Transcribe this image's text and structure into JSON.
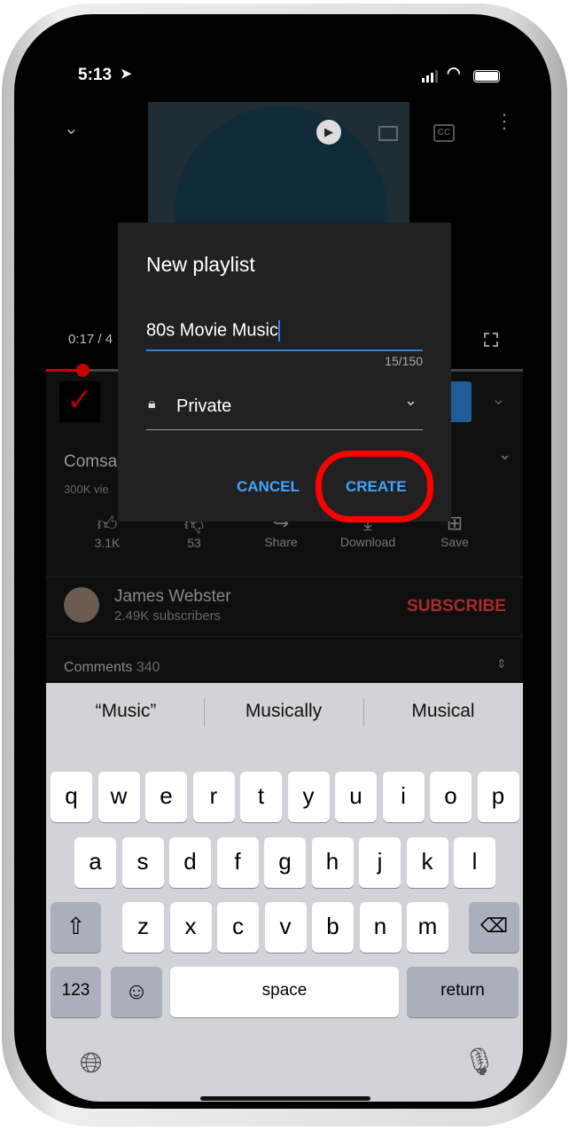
{
  "status_bar": {
    "time": "5:13"
  },
  "player": {
    "time": "0:17 / 4",
    "progress_fraction": 0.08
  },
  "video": {
    "title_partial": "Comsa",
    "views_partial": "300K vie",
    "actions": [
      {
        "label": "3.1K",
        "icon": "thumbs-up-icon"
      },
      {
        "label": "53",
        "icon": "thumbs-down-icon"
      },
      {
        "label": "Share",
        "icon": "share-icon"
      },
      {
        "label": "Download",
        "icon": "download-icon"
      },
      {
        "label": "Save",
        "icon": "save-icon"
      }
    ]
  },
  "channel": {
    "name": "James Webster",
    "subscribers": "2.49K subscribers",
    "subscribe_label": "SUBSCRIBE"
  },
  "comments": {
    "label": "Comments",
    "count": "340"
  },
  "dialog": {
    "title": "New playlist",
    "input_value": "80s Movie Music",
    "counter": "15/150",
    "privacy": "Private",
    "cancel": "CANCEL",
    "create": "CREATE"
  },
  "keyboard": {
    "suggestions": [
      "“Music”",
      "Musically",
      "Musical"
    ],
    "row1": [
      "q",
      "w",
      "e",
      "r",
      "t",
      "y",
      "u",
      "i",
      "o",
      "p"
    ],
    "row2": [
      "a",
      "s",
      "d",
      "f",
      "g",
      "h",
      "j",
      "k",
      "l"
    ],
    "row3": [
      "z",
      "x",
      "c",
      "v",
      "b",
      "n",
      "m"
    ],
    "numbers": "123",
    "space": "space",
    "return": "return"
  },
  "colors": {
    "accent": "#3ea6ff",
    "subscribe": "#a82a2a",
    "highlight": "#ff0000"
  }
}
